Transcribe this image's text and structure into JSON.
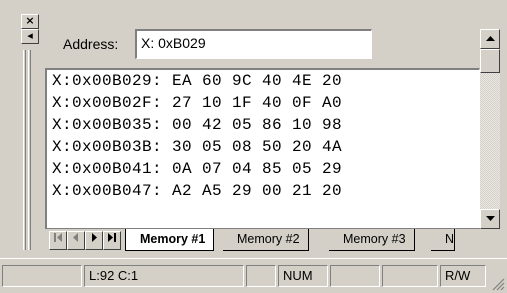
{
  "dock": {
    "close_glyph": "×",
    "pin_glyph": "◂"
  },
  "address": {
    "label": "Address:",
    "value": "X: 0xB029"
  },
  "memory_lines": [
    "X:0x00B029: EA 60 9C 40 4E 20",
    "X:0x00B02F: 27 10 1F 40 0F A0",
    "X:0x00B035: 00 42 05 86 10 98",
    "X:0x00B03B: 30 05 08 50 20 4A",
    "X:0x00B041: 0A 07 04 85 05 29",
    "X:0x00B047: A2 A5 29 00 21 20"
  ],
  "tabs": [
    {
      "label": "Memory #1",
      "active": true
    },
    {
      "label": "Memory #2",
      "active": false
    },
    {
      "label": "Memory #3",
      "active": false
    },
    {
      "label": "N",
      "active": false
    }
  ],
  "nav_icons": [
    "first-icon",
    "prev-icon",
    "next-icon",
    "last-icon"
  ],
  "status": {
    "position": "L:92 C:1",
    "num": "NUM",
    "rw": "R/W"
  },
  "colors": {
    "face": "#d4d0c8",
    "dump_bg": "#ffffff",
    "shadow": "#808080"
  }
}
